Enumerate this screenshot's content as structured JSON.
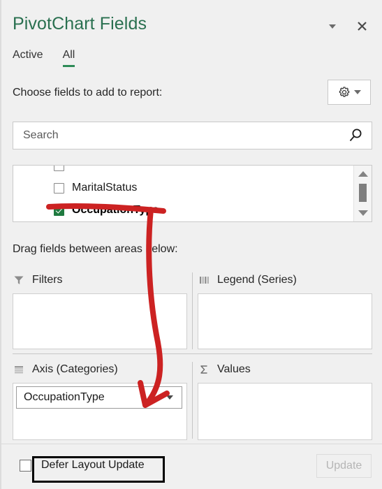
{
  "panel": {
    "title": "PivotChart Fields",
    "dropdown_icon": "chevron-down-icon",
    "close_icon": "close-icon"
  },
  "tabs": [
    {
      "label": "Active",
      "active": false
    },
    {
      "label": "All",
      "active": true
    }
  ],
  "choose_fields": {
    "label": "Choose fields to add to report:",
    "settings_icon": "gear-icon",
    "settings_caret_icon": "chevron-down-icon"
  },
  "search": {
    "value": "",
    "placeholder": "Search",
    "icon": "search-icon"
  },
  "field_list": {
    "items": [
      {
        "label": "MaritalStatus",
        "checked": false,
        "bold": false
      },
      {
        "label": "OccupationType",
        "checked": true,
        "bold": true
      }
    ],
    "scrollbar": {
      "up_icon": "scroll-up-arrow-icon",
      "down_icon": "scroll-down-arrow-icon"
    }
  },
  "drag_label": "Drag fields between areas below:",
  "areas": [
    {
      "name": "filters",
      "title": "Filters",
      "icon": "filter-funnel-icon",
      "chip": null
    },
    {
      "name": "legend",
      "title": "Legend (Series)",
      "icon": "legend-bars-icon",
      "chip": null
    },
    {
      "name": "axis",
      "title": "Axis (Categories)",
      "icon": "axis-rows-icon",
      "chip": {
        "label": "OccupationType",
        "caret_icon": "chevron-down-icon"
      }
    },
    {
      "name": "values",
      "title": "Values",
      "icon": "sigma-icon",
      "chip": null
    }
  ],
  "footer": {
    "defer_label": "Defer Layout Update",
    "defer_checked": false,
    "update_label": "Update",
    "update_disabled": true
  },
  "annotations": {
    "arrow_color": "#cc2222",
    "box_color": "#000000",
    "arrow_description": "red-arrow-from-occupationtype-to-axis-categories",
    "box_description": "black-box-around-defer-layout-update"
  },
  "colors": {
    "title_green": "#2a7050",
    "tab_underline_green": "#2e8b57",
    "checkbox_green": "#1f7a40",
    "panel_bg": "#f0f0f0"
  }
}
